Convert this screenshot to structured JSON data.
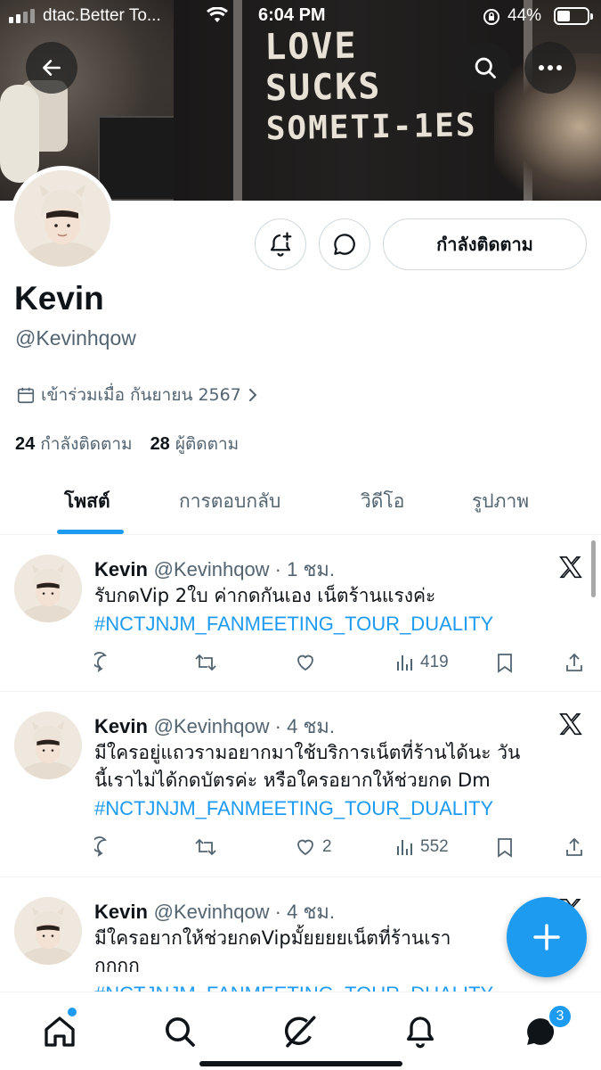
{
  "status_bar": {
    "carrier": "dtac.Better To...",
    "time": "6:04 PM",
    "battery_percent": "44%",
    "battery_level": 0.44
  },
  "banner": {
    "graffiti_lines": [
      "LOVE",
      "SUCKS",
      "SOMETI-1ES"
    ]
  },
  "header_buttons": {
    "back_icon": "arrow-left-icon",
    "search_icon": "search-icon",
    "more_icon": "more-horizontal-icon"
  },
  "profile": {
    "display_name": "Kevin",
    "handle": "@Kevinhqow",
    "joined_text": "เข้าร่วมเมื่อ กันยายน 2567",
    "following_count": "24",
    "following_label": "กำลังติดตาม",
    "followers_count": "28",
    "followers_label": "ผู้ติดตาม",
    "following_button_label": "กำลังติดตาม"
  },
  "tabs": [
    {
      "label": "โพสต์",
      "active": true
    },
    {
      "label": "การตอบกลับ",
      "active": false
    },
    {
      "label": "วิดีโอ",
      "active": false
    },
    {
      "label": "รูปภาพ",
      "active": false
    }
  ],
  "tweets": [
    {
      "name": "Kevin",
      "meta": "@Kevinhqow · 1 ชม.",
      "text_lines": [
        "รับกดVip 2ใบ ค่ากดกันเอง เน็ตร้านแรงค่ะ"
      ],
      "hashtag": "#NCTJNJM_FANMEETING_TOUR_DUALITY",
      "likes": "",
      "views": "419"
    },
    {
      "name": "Kevin",
      "meta": "@Kevinhqow · 4 ชม.",
      "text_lines": [
        "มีใครอยู่แถวรามอยากมาใช้บริการเน็ตที่ร้านได้นะ วัน",
        "นี้เราไม่ได้กดบัตรค่ะ หรือใครอยากให้ช่วยกด Dm"
      ],
      "hashtag": "#NCTJNJM_FANMEETING_TOUR_DUALITY",
      "likes": "2",
      "views": "552"
    },
    {
      "name": "Kevin",
      "meta": "@Kevinhqow · 4 ชม.",
      "text_lines": [
        "มีใครอยากให้ช่วยกดVipมั้ยยยยเน็ตที่ร้านเรา",
        "กกกก"
      ],
      "hashtag": "#NCTJNJM_FANMEETING_TOUR_DUALITY",
      "likes": "",
      "views": ""
    }
  ],
  "bottom_nav": {
    "items": [
      "home-icon",
      "search-icon",
      "grok-icon",
      "bell-icon",
      "messages-icon"
    ],
    "messages_badge": "3"
  },
  "colors": {
    "accent": "#1d9bf0",
    "text": "#0f1419",
    "secondary_text": "#536471",
    "border": "#cfd9de"
  }
}
